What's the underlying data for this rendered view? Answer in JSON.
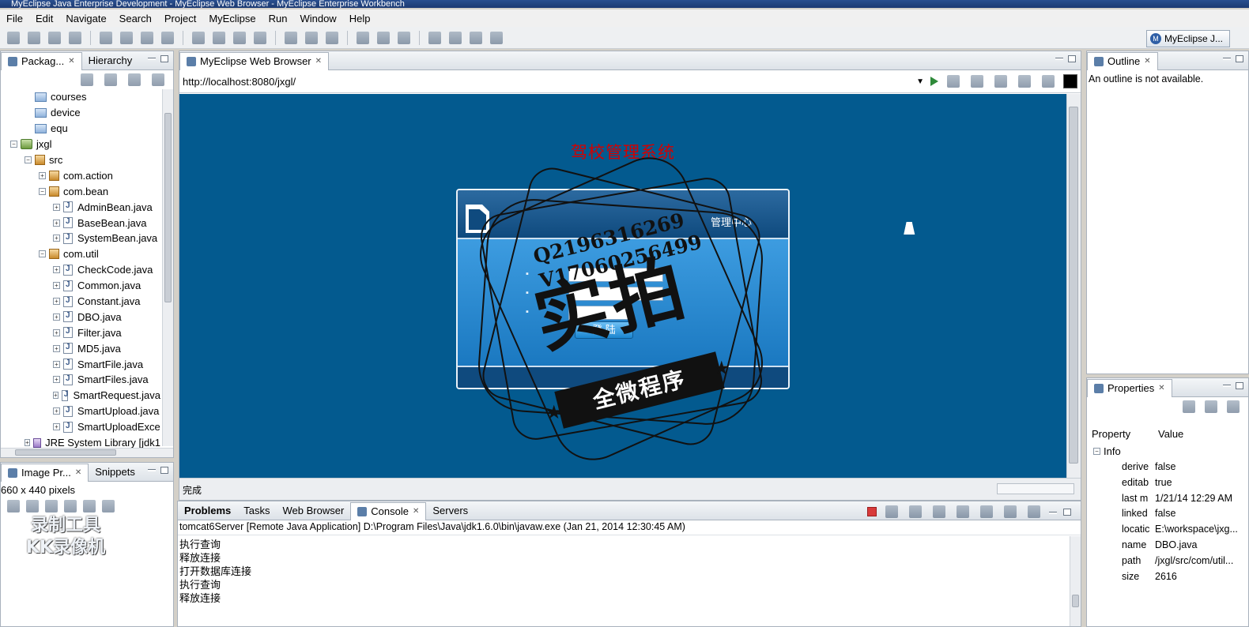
{
  "window": {
    "title": "MyEclipse Java Enterprise Development - MyEclipse Web Browser - MyEclipse Enterprise Workbench"
  },
  "menu": [
    "File",
    "Edit",
    "Navigate",
    "Search",
    "Project",
    "MyEclipse",
    "Run",
    "Window",
    "Help"
  ],
  "perspective": {
    "label": "MyEclipse J..."
  },
  "package_explorer": {
    "tabs": [
      "Packag...",
      "Hierarchy"
    ],
    "tree": [
      {
        "label": "courses",
        "indent": 1,
        "icon": "folder-icon",
        "exp": "none"
      },
      {
        "label": "device",
        "indent": 1,
        "icon": "folder-icon",
        "exp": "none"
      },
      {
        "label": "equ",
        "indent": 1,
        "icon": "folder-icon",
        "exp": "none"
      },
      {
        "label": "jxgl",
        "indent": 0,
        "icon": "project-icon",
        "exp": "-"
      },
      {
        "label": "src",
        "indent": 1,
        "icon": "source-folder-icon",
        "exp": "-"
      },
      {
        "label": "com.action",
        "indent": 2,
        "icon": "package-icon",
        "exp": "+"
      },
      {
        "label": "com.bean",
        "indent": 2,
        "icon": "package-icon",
        "exp": "-"
      },
      {
        "label": "AdminBean.java",
        "indent": 3,
        "icon": "java-file-icon",
        "exp": "+"
      },
      {
        "label": "BaseBean.java",
        "indent": 3,
        "icon": "java-file-icon",
        "exp": "+"
      },
      {
        "label": "SystemBean.java",
        "indent": 3,
        "icon": "java-file-icon",
        "exp": "+"
      },
      {
        "label": "com.util",
        "indent": 2,
        "icon": "package-icon",
        "exp": "-"
      },
      {
        "label": "CheckCode.java",
        "indent": 3,
        "icon": "java-file-icon",
        "exp": "+"
      },
      {
        "label": "Common.java",
        "indent": 3,
        "icon": "java-file-icon",
        "exp": "+"
      },
      {
        "label": "Constant.java",
        "indent": 3,
        "icon": "java-file-icon",
        "exp": "+"
      },
      {
        "label": "DBO.java",
        "indent": 3,
        "icon": "java-file-icon",
        "exp": "+"
      },
      {
        "label": "Filter.java",
        "indent": 3,
        "icon": "java-file-icon",
        "exp": "+"
      },
      {
        "label": "MD5.java",
        "indent": 3,
        "icon": "java-file-icon",
        "exp": "+"
      },
      {
        "label": "SmartFile.java",
        "indent": 3,
        "icon": "java-file-icon",
        "exp": "+"
      },
      {
        "label": "SmartFiles.java",
        "indent": 3,
        "icon": "java-file-icon",
        "exp": "+"
      },
      {
        "label": "SmartRequest.java",
        "indent": 3,
        "icon": "java-file-icon",
        "exp": "+"
      },
      {
        "label": "SmartUpload.java",
        "indent": 3,
        "icon": "java-file-icon",
        "exp": "+"
      },
      {
        "label": "SmartUploadExce",
        "indent": 3,
        "icon": "java-file-icon",
        "exp": "+"
      },
      {
        "label": "JRE System Library [jdk1",
        "indent": 1,
        "icon": "library-icon",
        "exp": "+"
      }
    ]
  },
  "browser": {
    "tab": "MyEclipse Web Browser",
    "url": "http://localhost:8080/jxgl/",
    "page_title": "驾校管理系统",
    "login_header": "管理中心",
    "login_button": "登 陆",
    "status": "完成"
  },
  "watermark": {
    "qq": "Q2196316269",
    "vx": "V17060256499",
    "main": "实拍",
    "ribbon": "全微程序"
  },
  "image_preview": {
    "tabs": [
      "Image Pr...",
      "Snippets"
    ],
    "size": "660 x 440 pixels",
    "overlay_line1": "录制工具",
    "overlay_line2": "KK录像机"
  },
  "console": {
    "tabs": [
      "Problems",
      "Tasks",
      "Web Browser",
      "Console",
      "Servers"
    ],
    "header": "tomcat6Server [Remote Java Application] D:\\Program Files\\Java\\jdk1.6.0\\bin\\javaw.exe (Jan 21, 2014 12:30:45 AM)",
    "lines": [
      "执行查询",
      "释放连接",
      "打开数据库连接",
      "执行查询",
      "释放连接"
    ]
  },
  "outline": {
    "tab": "Outline",
    "message": "An outline is not available."
  },
  "properties": {
    "tab": "Properties",
    "col_property": "Property",
    "col_value": "Value",
    "group": "Info",
    "rows": [
      {
        "key": "derive",
        "value": "false"
      },
      {
        "key": "editab",
        "value": "true"
      },
      {
        "key": "last m",
        "value": "1/21/14 12:29 AM"
      },
      {
        "key": "linked",
        "value": "false"
      },
      {
        "key": "locatic",
        "value": "E:\\workspace\\jxg..."
      },
      {
        "key": "name",
        "value": "DBO.java"
      },
      {
        "key": "path",
        "value": "/jxgl/src/com/util..."
      },
      {
        "key": "size",
        "value": "2616"
      }
    ]
  }
}
